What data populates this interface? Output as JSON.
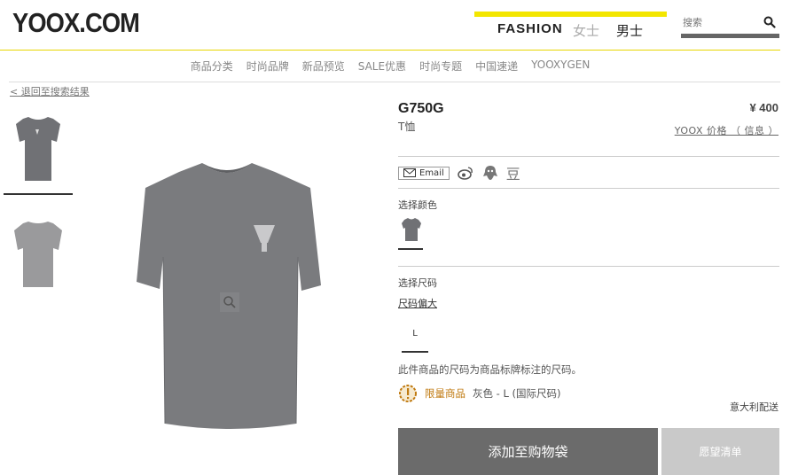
{
  "header": {
    "logo": "YOOX.COM",
    "gender": {
      "fashion": "FASHION",
      "women": "女士",
      "men": "男士"
    },
    "search": {
      "placeholder": "搜索"
    }
  },
  "nav": [
    "商品分类",
    "时尚品牌",
    "新品预览",
    "SALE优惠",
    "时尚专题",
    "中国速递",
    "YOOXYGEN"
  ],
  "back_link": "< 退回至搜索结果",
  "product": {
    "name": "G750G",
    "type": "T恤",
    "price": "¥ 400",
    "price_info": "YOOX 价格 （ 信息 ）",
    "shirt_color": "#7a7b7e"
  },
  "share": {
    "email_label": "Email",
    "douban": "豆"
  },
  "color_section": {
    "label": "选择颜色"
  },
  "size_section": {
    "label": "选择尺码",
    "guide": "尺码偏大",
    "selected": "L",
    "note": "此件商品的尺码为商品标牌标注的尺码。"
  },
  "availability": {
    "limited": "限量商品",
    "variant": "灰色 - L (国际尺码)",
    "shipping": "意大利配送"
  },
  "actions": {
    "add_to_cart": "添加至购物袋",
    "wishlist": "愿望清单"
  },
  "colors": {
    "accent": "#f3e600",
    "button_dark": "#6b6b6b",
    "button_light": "#c9c9c9",
    "limited": "#c07a10"
  }
}
